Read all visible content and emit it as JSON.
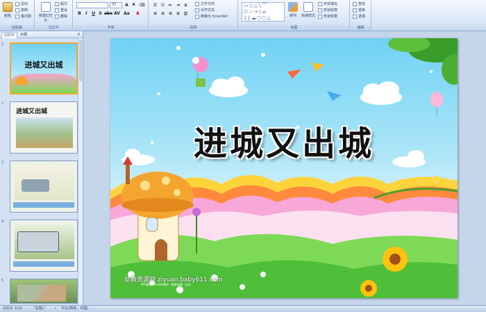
{
  "ribbon": {
    "clipboard": {
      "paste": "粘贴",
      "cut": "剪切",
      "copy": "复制",
      "format_painter": "格式刷",
      "group": "剪贴板"
    },
    "slides": {
      "new_slide": "新建幻灯片",
      "layout": "版式",
      "reset": "重设",
      "delete": "删除",
      "group": "幻灯片"
    },
    "font": {
      "font_name": "",
      "font_size": "37",
      "group": "字体"
    },
    "paragraph": {
      "text_direction": "文字方向",
      "align_text": "对齐文本",
      "smartart": "转换为 SmartArt",
      "group": "段落"
    },
    "drawing": {
      "arrange": "排列",
      "quick_styles": "快速样式",
      "shape_fill": "形状填充",
      "shape_outline": "形状轮廓",
      "shape_effects": "形状效果",
      "group": "绘图"
    },
    "editing": {
      "find": "查找",
      "replace": "替换",
      "select": "选择",
      "group": "编辑"
    }
  },
  "left_panel": {
    "tabs": [
      "幻灯片",
      "大纲"
    ],
    "close": "×",
    "thumbnails": [
      {
        "num": "1",
        "title": "进城又出城"
      },
      {
        "num": "2",
        "title": "进城又出城"
      },
      {
        "num": "3",
        "title": ""
      },
      {
        "num": "4",
        "title": ""
      },
      {
        "num": "5",
        "title": ""
      }
    ]
  },
  "slide": {
    "title": "进城又出城",
    "watermark": "幼教资源网 ziyuan.baby611.com",
    "sub_watermark": "PPT课件 · FLASH课件 · 教案试题 · 论文"
  },
  "statusbar": {
    "slide_info": "幻灯片 1/13",
    "theme": "\"主题1\"",
    "language": "中文(简体，中国)"
  },
  "colors": {
    "accent": "#f0a830",
    "ribbon": "#dbe7f6",
    "sky": "#6fd2f4"
  }
}
